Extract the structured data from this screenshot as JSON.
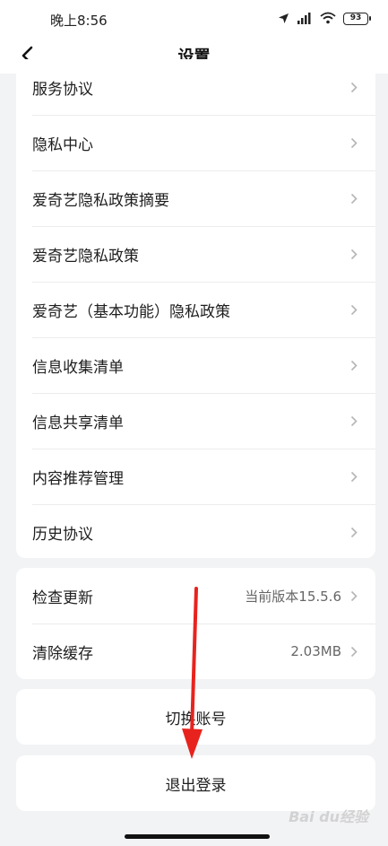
{
  "status_bar": {
    "time": "晚上8:56",
    "battery": "93",
    "icons": [
      "location-icon",
      "signal-icon",
      "wifi-icon",
      "battery-icon"
    ]
  },
  "nav": {
    "title": "设置"
  },
  "policy_items": [
    {
      "label": "服务协议"
    },
    {
      "label": "隐私中心"
    },
    {
      "label": "爱奇艺隐私政策摘要"
    },
    {
      "label": "爱奇艺隐私政策"
    },
    {
      "label": "爱奇艺（基本功能）隐私政策"
    },
    {
      "label": "信息收集清单"
    },
    {
      "label": "信息共享清单"
    },
    {
      "label": "内容推荐管理"
    },
    {
      "label": "历史协议"
    }
  ],
  "system_items": [
    {
      "label": "检查更新",
      "value": "当前版本15.5.6"
    },
    {
      "label": "清除缓存",
      "value": "2.03MB"
    }
  ],
  "switch_account_label": "切换账号",
  "logout_label": "退出登录",
  "watermark": "Bai du经验",
  "colors": {
    "background": "#f2f3f5",
    "card": "#ffffff",
    "arrow": "#e8231e",
    "text": "#1e1e1e",
    "secondary_text": "#666666"
  }
}
